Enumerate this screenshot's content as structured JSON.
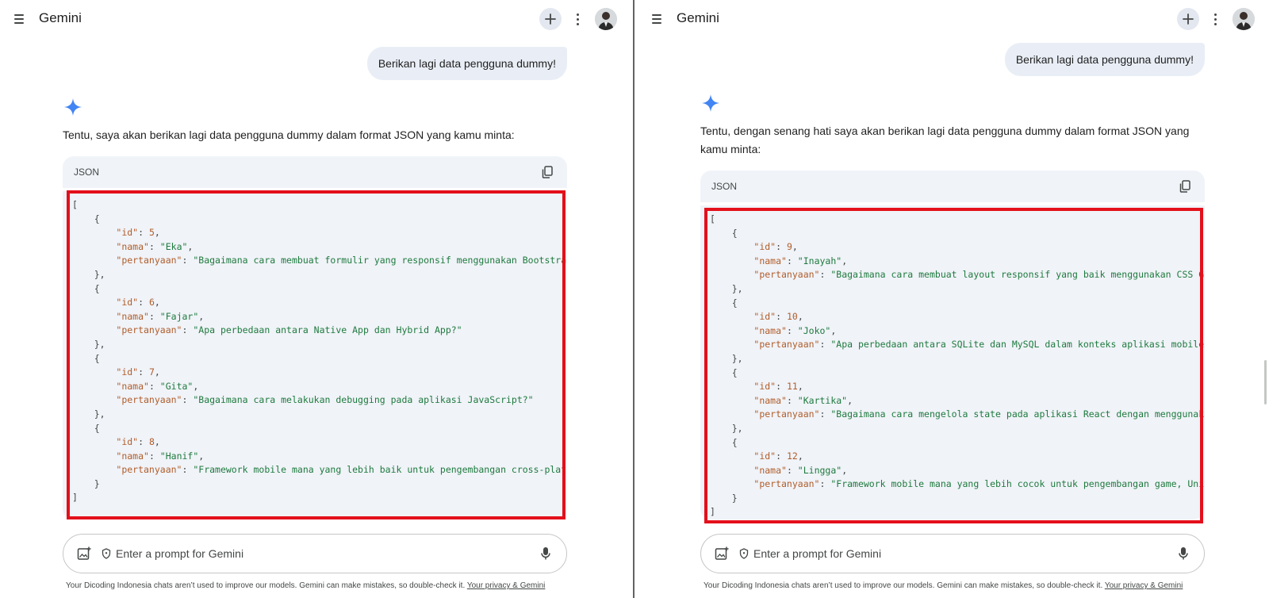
{
  "app": {
    "title": "Gemini"
  },
  "colors": {
    "highlight": "#e3101b",
    "sparkle": "#4285f4",
    "code_bg": "#f0f3f8",
    "bubble_bg": "#e9eef6"
  },
  "prompt": {
    "placeholder": "Enter a prompt for Gemini"
  },
  "disclaimer": {
    "text": "Your Dicoding Indonesia chats aren’t used to improve our models. Gemini can make mistakes, so double-check it. ",
    "link": "Your privacy & Gemini"
  },
  "panes": [
    {
      "user_message": "Berikan lagi data pengguna dummy!",
      "response_text": "Tentu, saya akan berikan lagi data pengguna dummy dalam format JSON yang kamu minta:",
      "code_lang": "JSON",
      "records": [
        {
          "id": "5",
          "nama": "\"Eka\"",
          "pertanyaan": "\"Bagaimana cara membuat formulir yang responsif menggunakan Bootstrap?\""
        },
        {
          "id": "6",
          "nama": "\"Fajar\"",
          "pertanyaan": "\"Apa perbedaan antara Native App dan Hybrid App?\""
        },
        {
          "id": "7",
          "nama": "\"Gita\"",
          "pertanyaan": "\"Bagaimana cara melakukan debugging pada aplikasi JavaScript?\""
        },
        {
          "id": "8",
          "nama": "\"Hanif\"",
          "pertanyaan": "\"Framework mobile mana yang lebih baik untuk pengembangan cross-platform?\""
        }
      ]
    },
    {
      "user_message": "Berikan lagi data pengguna dummy!",
      "response_text": "Tentu, dengan senang hati saya akan berikan lagi data pengguna dummy dalam format JSON yang kamu minta:",
      "code_lang": "JSON",
      "records": [
        {
          "id": "9",
          "nama": "\"Inayah\"",
          "pertanyaan": "\"Bagaimana cara membuat layout responsif yang baik menggunakan CSS Grid?\""
        },
        {
          "id": "10",
          "nama": "\"Joko\"",
          "pertanyaan": "\"Apa perbedaan antara SQLite dan MySQL dalam konteks aplikasi mobile?\""
        },
        {
          "id": "11",
          "nama": "\"Kartika\"",
          "pertanyaan": "\"Bagaimana cara mengelola state pada aplikasi React dengan menggunakan Redux?\""
        },
        {
          "id": "12",
          "nama": "\"Lingga\"",
          "pertanyaan": "\"Framework mobile mana yang lebih cocok untuk pengembangan game, Unity atau Flutter?\""
        }
      ]
    }
  ]
}
